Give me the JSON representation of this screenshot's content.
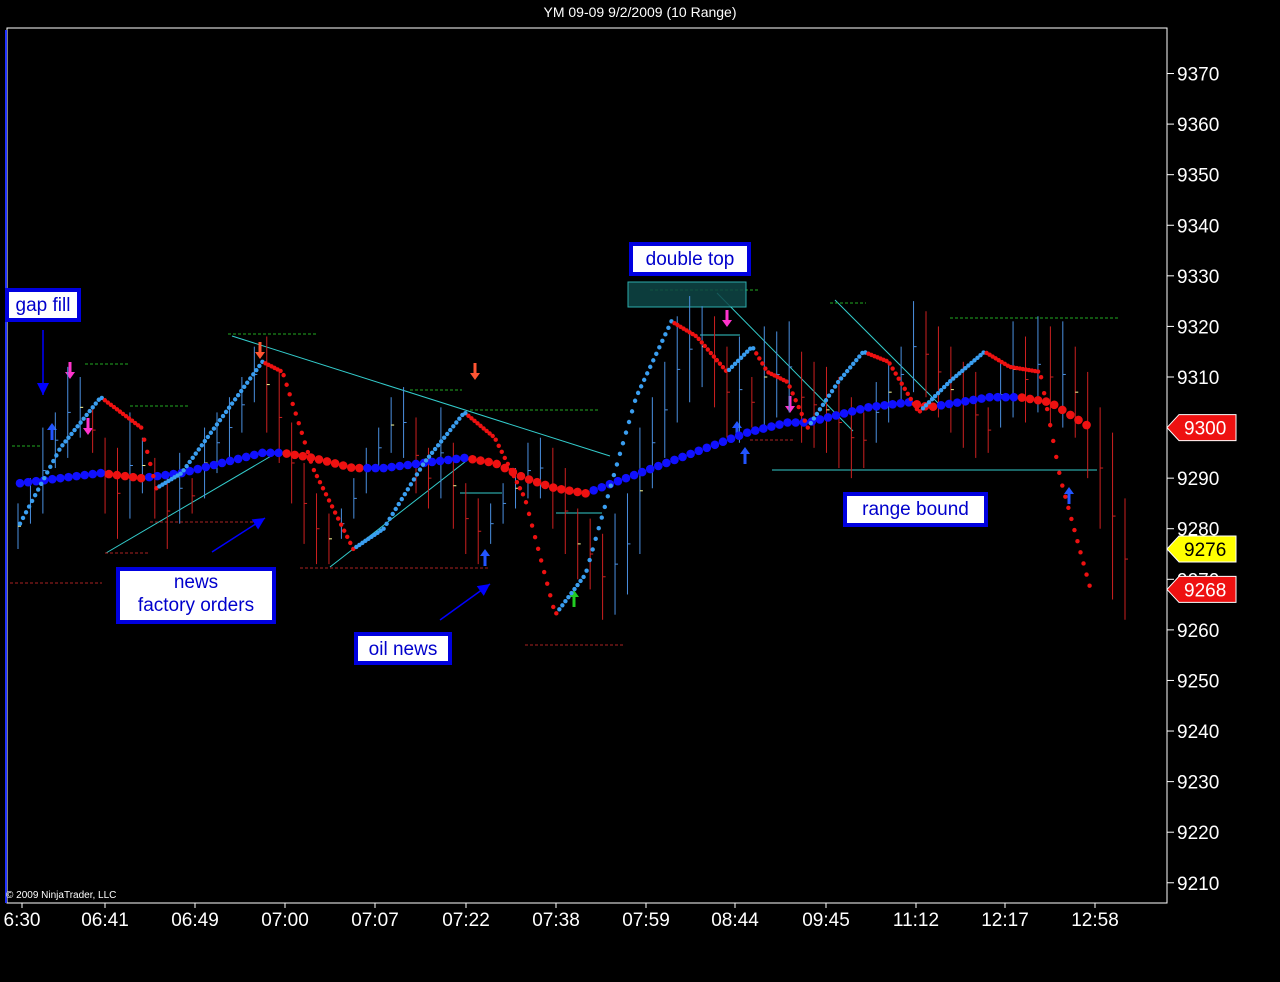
{
  "window": {
    "title": "YM 09-09  9/2/2009 (10 Range)"
  },
  "copyright": "© 2009 NinjaTrader, LLC",
  "annotations": {
    "gap_fill": "gap fill",
    "double_top": "double top",
    "news_line1": "news",
    "news_line2": "factory orders",
    "oil_news": "oil news",
    "range_bound": "range bound"
  },
  "colors": {
    "background": "#000000",
    "fast_ma": "#3a9ef0",
    "slow_ma_rising": "#1010ff",
    "falling": "#ee1111",
    "trendline": "#33cccc",
    "price_label_red": "#ee1111",
    "price_label_yellow": "#ffff00"
  },
  "chart_data": {
    "type": "line",
    "instrument": "YM 09-09",
    "ylim": [
      9206,
      9379
    ],
    "yticks": [
      9210,
      9220,
      9230,
      9240,
      9250,
      9260,
      9270,
      9280,
      9290,
      9300,
      9310,
      9320,
      9330,
      9340,
      9350,
      9360,
      9370
    ],
    "xticks": [
      "6:30",
      "06:41",
      "06:49",
      "07:00",
      "07:07",
      "07:22",
      "07:38",
      "07:59",
      "08:44",
      "09:45",
      "11:12",
      "12:17",
      "12:58"
    ],
    "price_labels": [
      {
        "value": 9300,
        "text": "9300",
        "color": "#ee1111",
        "text_color": "#ffffff"
      },
      {
        "value": 9276,
        "text": "9276",
        "color": "#ffff00",
        "text_color": "#000000"
      },
      {
        "value": 9268,
        "text": "9268",
        "color": "#ee1111",
        "text_color": "#ffffff"
      }
    ],
    "series": [
      {
        "role": "fast moving average",
        "color_up": "#3a9ef0",
        "color_down": "#ee1111",
        "x": [
          0,
          4,
          8,
          12,
          13.5,
          16,
          20,
          24,
          26,
          29,
          33,
          36,
          40,
          44,
          47,
          50,
          53,
          56,
          61,
          64.5,
          67,
          70,
          72.5,
          74,
          76,
          78,
          81,
          83.5,
          86,
          89,
          92,
          95.5,
          98,
          101,
          103,
          106
        ],
        "y": [
          9281,
          9296,
          9306,
          9300,
          9288,
          9291,
          9302,
          9313,
          9311,
          9292,
          9276,
          9280,
          9293,
          9303,
          9298,
          9286,
          9263,
          9271,
          9306,
          9321,
          9318,
          9311,
          9316,
          9311,
          9309,
          9300,
          9309,
          9315,
          9313,
          9303,
          9309,
          9315,
          9312,
          9311,
          9290,
          9268
        ]
      },
      {
        "role": "slow moving average",
        "color_up": "#1010ff",
        "color_down": "#ee1111",
        "x": [
          0,
          4,
          8,
          12,
          16,
          20,
          24,
          26,
          29,
          33,
          36,
          40,
          44,
          47,
          50,
          53,
          56,
          60,
          64,
          68,
          72,
          76,
          78,
          80,
          84,
          88,
          90,
          93,
          96,
          99,
          102,
          106
        ],
        "y": [
          9289,
          9290,
          9291,
          9290,
          9291,
          9293,
          9295,
          9295,
          9294,
          9292,
          9292,
          9293,
          9294,
          9293,
          9290,
          9288,
          9287,
          9290,
          9293,
          9296,
          9299,
          9301,
          9301,
          9302,
          9304,
          9305,
          9304,
          9305,
          9306,
          9306,
          9305,
          9300
        ]
      }
    ],
    "bars": {
      "high": [
        9285,
        9290,
        9300,
        9303,
        9312,
        9310,
        9304,
        9298,
        9296,
        9303,
        9298,
        9294,
        9291,
        9295,
        9290,
        9300,
        9303,
        9306,
        9310,
        9316,
        9318,
        9311,
        9301,
        9293,
        9287,
        9283,
        9284,
        9290,
        9296,
        9300,
        9306,
        9308,
        9302,
        9296,
        9304,
        9297,
        9289,
        9286,
        9285,
        9289,
        9292,
        9297,
        9298,
        9296,
        9292,
        9284,
        9282,
        9279,
        9283,
        9287,
        9300,
        9306,
        9313,
        9322,
        9326,
        9324,
        9322,
        9316,
        9318,
        9310,
        9320,
        9319,
        9321,
        9315,
        9313,
        9312,
        9310,
        9306,
        9303,
        9309,
        9313,
        9316,
        9325,
        9323,
        9320,
        9316,
        9313,
        9311,
        9304,
        9313,
        9321,
        9318,
        9322,
        9320,
        9321,
        9316,
        9311,
        9304,
        9299,
        9286
      ],
      "low": [
        9276,
        9281,
        9283,
        9292,
        9294,
        9298,
        9295,
        9283,
        9278,
        9282,
        9287,
        9282,
        9276,
        9281,
        9283,
        9286,
        9291,
        9294,
        9299,
        9305,
        9299,
        9293,
        9285,
        9277,
        9273,
        9273,
        9278,
        9282,
        9287,
        9292,
        9295,
        9294,
        9287,
        9284,
        9286,
        9280,
        9275,
        9273,
        9277,
        9281,
        9284,
        9286,
        9286,
        9280,
        9275,
        9270,
        9268,
        9262,
        9263,
        9267,
        9275,
        9288,
        9294,
        9301,
        9305,
        9308,
        9304,
        9298,
        9297,
        9300,
        9300,
        9302,
        9303,
        9297,
        9296,
        9295,
        9292,
        9290,
        9292,
        9297,
        9301,
        9305,
        9307,
        9306,
        9302,
        9299,
        9296,
        9294,
        9295,
        9300,
        9302,
        9301,
        9303,
        9300,
        9300,
        9298,
        9290,
        9280,
        9266,
        9262
      ]
    }
  }
}
